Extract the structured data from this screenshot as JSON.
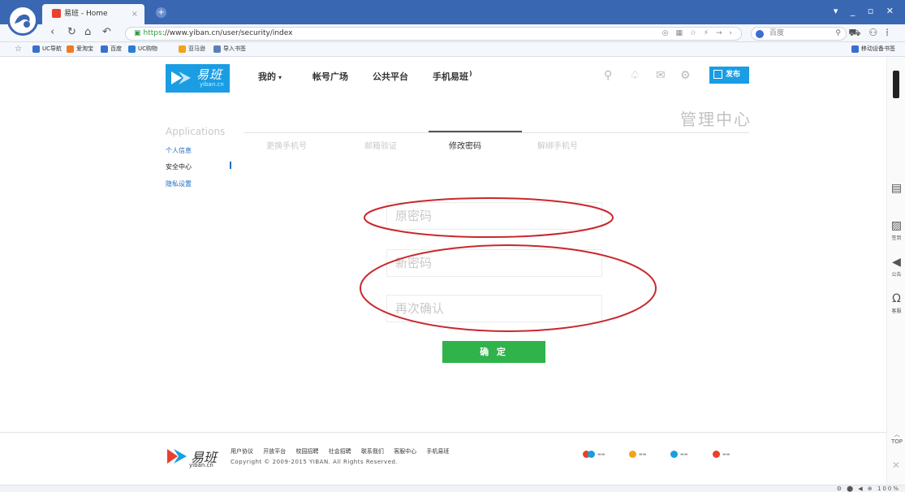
{
  "browser": {
    "tab_title": "易班 - Home",
    "url_prefix": "https",
    "url_rest": "://www.yiban.cn/user/security/index",
    "search_engine": "百度",
    "window_controls": "▾ _ ▫ ✕",
    "bookmarks": [
      "UC导航",
      "爱淘宝",
      "百度",
      "UC购物",
      "亚马逊",
      "导入书签"
    ],
    "mobile_bookmarks": "移动设备书签",
    "zoom": "100%"
  },
  "header": {
    "logo_text": "易班",
    "logo_sub": "yiban.cn",
    "nav": [
      "我的",
      "帐号广场",
      "公共平台",
      "手机易班"
    ],
    "publish_label": "发布"
  },
  "page": {
    "mgmt_title": "管理中心",
    "apps_title": "Applications",
    "sidebar": [
      "个人信息",
      "安全中心",
      "隐私设置"
    ],
    "tabs": [
      "更换手机号",
      "邮箱验证",
      "修改密码",
      "解绑手机号"
    ],
    "fields": {
      "old_placeholder": "原密码",
      "new_placeholder": "新密码",
      "confirm_placeholder": "再次确认"
    },
    "submit_label": "确 定"
  },
  "right_rail": {
    "items": [
      "签到",
      "公告",
      "客服"
    ],
    "top_label": "TOP"
  },
  "footer": {
    "logo_text": "易班",
    "logo_sub": "yiban.cn",
    "links": [
      "用户协议",
      "开放平台",
      "校园招聘",
      "社会招聘",
      "联系我们",
      "客服中心",
      "手机易班"
    ],
    "copyright": "Copyright © 2009-2015 YIBAN. All Rights Reserved."
  },
  "colors": {
    "brand_blue": "#1a9de3",
    "submit_green": "#2fb34a",
    "annotation_red": "#c8282d",
    "chrome_blue": "#3a67b2"
  }
}
